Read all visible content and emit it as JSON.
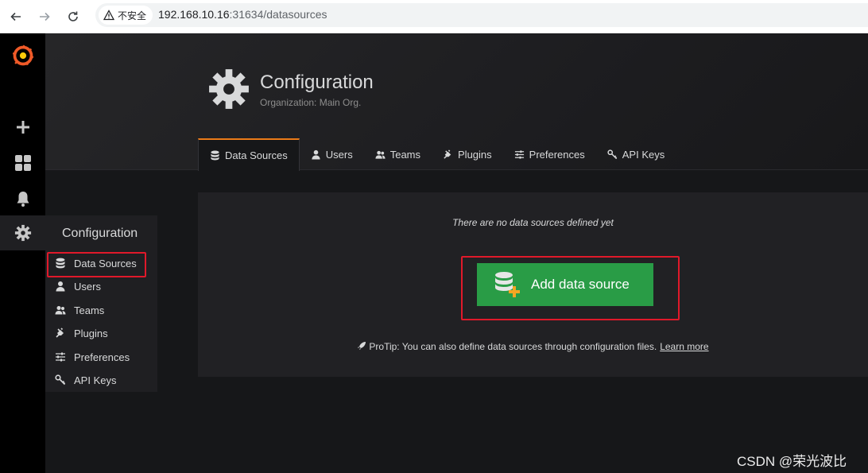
{
  "browser": {
    "security_label": "不安全",
    "url_host": "192.168.10.16",
    "url_rest": ":31634/datasources"
  },
  "sidemenu": {
    "icons": [
      "grafana-logo-icon",
      "plus-icon",
      "dashboards-icon",
      "bell-icon",
      "gear-icon"
    ]
  },
  "header": {
    "title": "Configuration",
    "subtitle": "Organization: Main Org."
  },
  "tabs": [
    {
      "label": "Data Sources",
      "icon": "database-icon",
      "active": true
    },
    {
      "label": "Users",
      "icon": "user-icon"
    },
    {
      "label": "Teams",
      "icon": "users-icon"
    },
    {
      "label": "Plugins",
      "icon": "plug-icon"
    },
    {
      "label": "Preferences",
      "icon": "sliders-icon"
    },
    {
      "label": "API Keys",
      "icon": "key-icon"
    }
  ],
  "panel": {
    "empty_message": "There are no data sources defined yet",
    "add_button_label": "Add data source",
    "protip_text": "ProTip: You can also define data sources through configuration files.",
    "learn_more": "Learn more"
  },
  "dropdown": {
    "title": "Configuration",
    "items": [
      {
        "label": "Data Sources",
        "icon": "database-icon"
      },
      {
        "label": "Users",
        "icon": "user-icon"
      },
      {
        "label": "Teams",
        "icon": "users-icon"
      },
      {
        "label": "Plugins",
        "icon": "plug-icon"
      },
      {
        "label": "Preferences",
        "icon": "sliders-icon"
      },
      {
        "label": "API Keys",
        "icon": "key-icon"
      }
    ]
  },
  "colors": {
    "accent_orange": "#eb7b18",
    "button_green": "#299c46",
    "highlight_red": "#e0192a"
  },
  "watermark": "CSDN @荣光波比"
}
